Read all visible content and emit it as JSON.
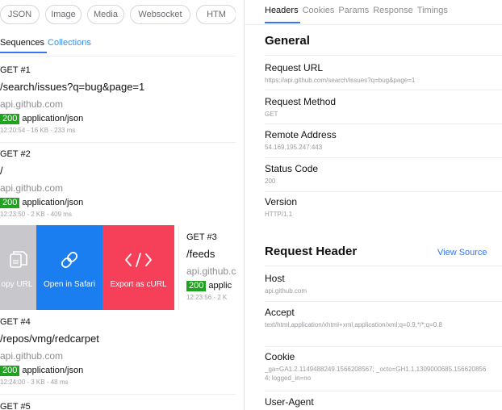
{
  "filters": [
    "JSON",
    "Image",
    "Media",
    "Websocket",
    "HTM"
  ],
  "segments": {
    "active": "Sequences",
    "inactive": "Collections"
  },
  "requests": [
    {
      "method": "GET  #1",
      "path": "/search/issues?q=bug&page=1",
      "host": "api.github.com",
      "status": "200",
      "content_type": "application/json",
      "meta": "12:20:54 - 16 KB - 233 ms"
    },
    {
      "method": "GET  #2",
      "path": "/",
      "host": "api.github.com",
      "status": "200",
      "content_type": "application/json",
      "meta": "12:23:50 - 2 KB - 409 ms"
    },
    {
      "method": "GET  #3",
      "path": "/feeds",
      "host": "api.github.c",
      "status": "200",
      "content_type": "applic",
      "meta": "12:23:56 - 2 K"
    },
    {
      "method": "GET  #4",
      "path": "/repos/vmg/redcarpet",
      "host": "api.github.com",
      "status": "200",
      "content_type": "application/json",
      "meta": "12:24:00 - 3 KB - 48 ms"
    },
    {
      "method": "GET  #5"
    }
  ],
  "swipe_actions": {
    "copy": "opy URL",
    "safari": "Open in Safari",
    "curl": "Export as cURL"
  },
  "detail_tabs": [
    "Headers",
    "Cookies",
    "Params",
    "Response",
    "Timings"
  ],
  "general": {
    "title": "General",
    "fields": [
      {
        "key": "Request URL",
        "value": "https://api.github.com/search/issues?q=bug&page=1"
      },
      {
        "key": "Request Method",
        "value": "GET"
      },
      {
        "key": "Remote Address",
        "value": "54.169.195.247:443"
      },
      {
        "key": "Status Code",
        "value": "200"
      },
      {
        "key": "Version",
        "value": "HTTP/1.1"
      }
    ]
  },
  "request_header": {
    "title": "Request Header",
    "view_source": "View Source",
    "fields": [
      {
        "key": "Host",
        "value": "api.github.com"
      },
      {
        "key": "Accept",
        "value": "text/html,application/xhtml+xml,application/xml;q=0.9,*/*;q=0.8"
      },
      {
        "key": "Cookie",
        "value": "_ga=GA1.2.1149488249.1566208567; _octo=GH1.1.1309000685.1566208564; logged_in=no"
      },
      {
        "key": "User-Agent",
        "value": ""
      }
    ]
  },
  "colors": {
    "accent": "#3478f6",
    "status_ok": "#1fa31f",
    "safari": "#1a7df0",
    "curl": "#f6405a",
    "copy": "#c7c7cc"
  }
}
